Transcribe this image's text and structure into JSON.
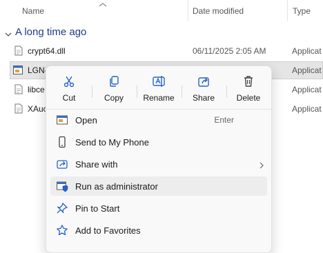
{
  "columns": {
    "name": "Name",
    "date_modified": "Date modified",
    "type": "Type"
  },
  "group": {
    "title": "A long time ago"
  },
  "files": [
    {
      "name": "crypt64.dll",
      "date": "06/11/2025 2:05 AM",
      "type": "Applicat",
      "icon": "dll-file-icon"
    },
    {
      "name": "LGN-",
      "date": "",
      "type": "Applicat",
      "icon": "exe-file-icon"
    },
    {
      "name": "libce",
      "date": "",
      "type": "Applicat",
      "icon": "dll-file-icon"
    },
    {
      "name": "XAuc",
      "date": "",
      "type": "Applicat",
      "icon": "dll-file-icon"
    }
  ],
  "context_menu": {
    "quick_actions": [
      {
        "label": "Cut",
        "icon": "scissors-icon"
      },
      {
        "label": "Copy",
        "icon": "copy-icon"
      },
      {
        "label": "Rename",
        "icon": "rename-icon"
      },
      {
        "label": "Share",
        "icon": "share-icon"
      },
      {
        "label": "Delete",
        "icon": "trash-icon"
      }
    ],
    "items": [
      {
        "label": "Open",
        "shortcut": "Enter",
        "icon": "open-app-icon"
      },
      {
        "label": "Send to My Phone",
        "icon": "phone-icon"
      },
      {
        "label": "Share with",
        "icon": "share-with-icon",
        "submenu": true
      },
      {
        "label": "Run as administrator",
        "icon": "shield-icon",
        "highlighted": true
      },
      {
        "label": "Pin to Start",
        "icon": "pin-icon"
      },
      {
        "label": "Add to Favorites",
        "icon": "star-icon"
      }
    ]
  },
  "colors": {
    "accent": "#1e3a8a",
    "selection": "#e5e5e5",
    "menu_bg": "#f9f9f9",
    "icon_blue": "#2563c9"
  }
}
